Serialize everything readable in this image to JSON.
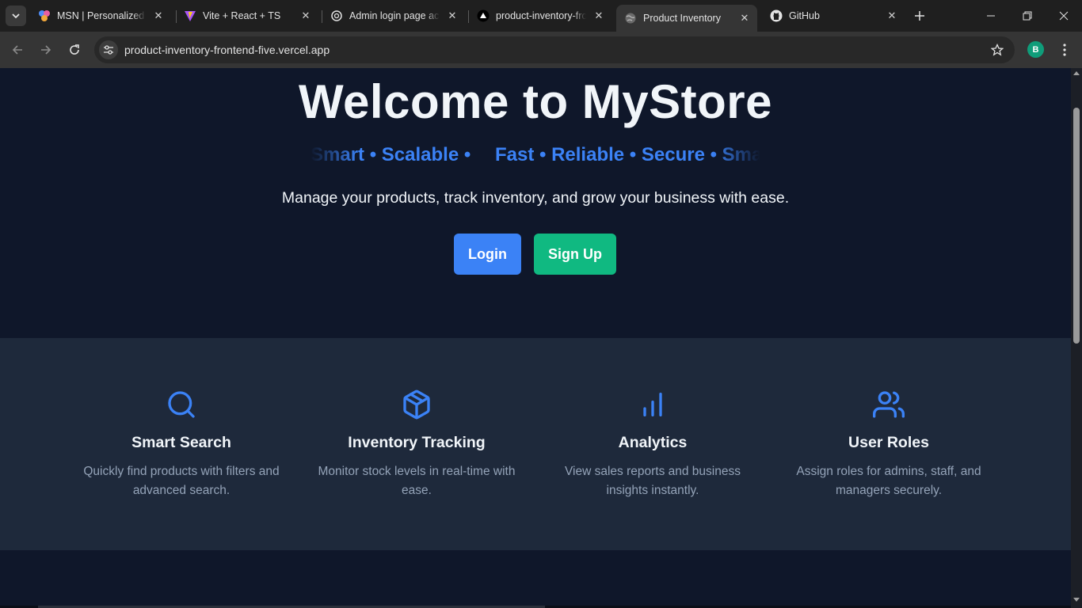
{
  "browser": {
    "tabs": [
      {
        "label": "MSN | Personalized News",
        "favicon": "msn-icon"
      },
      {
        "label": "Vite + React + TS",
        "favicon": "vite-icon"
      },
      {
        "label": "Admin login page access",
        "favicon": "chatgpt-icon"
      },
      {
        "label": "product-inventory-frontend",
        "favicon": "vercel-icon"
      },
      {
        "label": "Product Inventory",
        "favicon": "globe-icon",
        "active": true
      },
      {
        "label": "GitHub",
        "favicon": "github-icon"
      }
    ],
    "url": "product-inventory-frontend-five.vercel.app",
    "profile_initial": "B",
    "profile_color": "#0f9d7a"
  },
  "hero": {
    "title": "Welcome to MyStore",
    "tagline_a": "Smart • Scalable •",
    "tagline_b": "Fast • Reliable • Secure • Smart",
    "subtitle": "Manage your products, track inventory, and grow your business with ease.",
    "login_label": "Login",
    "signup_label": "Sign Up",
    "accent_blue": "#3b82f6",
    "accent_green": "#10b981"
  },
  "features": [
    {
      "icon": "search-icon",
      "title": "Smart Search",
      "description": "Quickly find products with filters and advanced search."
    },
    {
      "icon": "box-icon",
      "title": "Inventory Tracking",
      "description": "Monitor stock levels in real-time with ease."
    },
    {
      "icon": "bar-chart-icon",
      "title": "Analytics",
      "description": "View sales reports and business insights instantly."
    },
    {
      "icon": "users-icon",
      "title": "User Roles",
      "description": "Assign roles for admins, staff, and managers securely."
    }
  ]
}
